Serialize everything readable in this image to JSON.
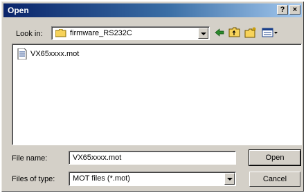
{
  "window": {
    "title": "Open"
  },
  "titlebar_buttons": {
    "help": "?",
    "close": "×"
  },
  "look_in": {
    "label": "Look in:",
    "value": "firmware_RS232C"
  },
  "files": [
    {
      "name": "VX65xxxx.mot"
    }
  ],
  "file_name": {
    "label": "File name:",
    "value": "VX65xxxx.mot"
  },
  "file_type": {
    "label": "Files of type:",
    "value": "MOT files (*.mot)"
  },
  "buttons": {
    "open": "Open",
    "cancel": "Cancel"
  },
  "colors": {
    "title_start": "#0a246a",
    "title_end": "#a6caf0",
    "face": "#d4d0c8"
  }
}
